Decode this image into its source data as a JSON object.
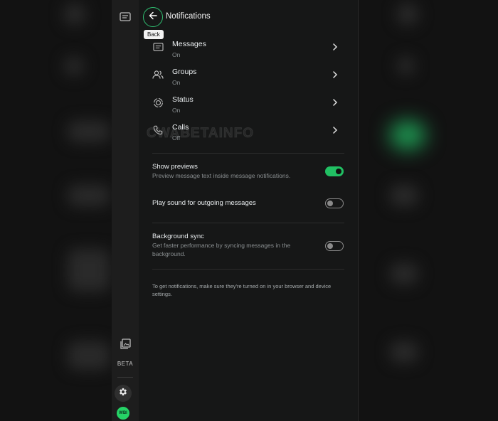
{
  "header": {
    "title": "Notifications",
    "back_tooltip": "Back"
  },
  "rows": [
    {
      "label": "Messages",
      "status": "On",
      "icon": "message-icon"
    },
    {
      "label": "Groups",
      "status": "On",
      "icon": "groups-icon"
    },
    {
      "label": "Status",
      "status": "On",
      "icon": "status-icon"
    },
    {
      "label": "Calls",
      "status": "Off",
      "icon": "phone-icon"
    }
  ],
  "options": {
    "show_previews": {
      "label": "Show previews",
      "description": "Preview message text inside message notifications.",
      "enabled": true
    },
    "play_sound": {
      "label": "Play sound for outgoing messages",
      "enabled": false
    },
    "background_sync": {
      "label": "Background sync",
      "description": "Get faster performance by syncing messages in the background.",
      "enabled": false
    }
  },
  "footer_note": "To get notifications, make sure they're turned on in your browser and device settings.",
  "rail": {
    "beta_label": "BETA",
    "avatar_text": "WBI"
  },
  "watermark": "CWABETAINFO",
  "colors": {
    "accent": "#21c063",
    "background": "#161717",
    "text_secondary": "#8a8f91"
  }
}
